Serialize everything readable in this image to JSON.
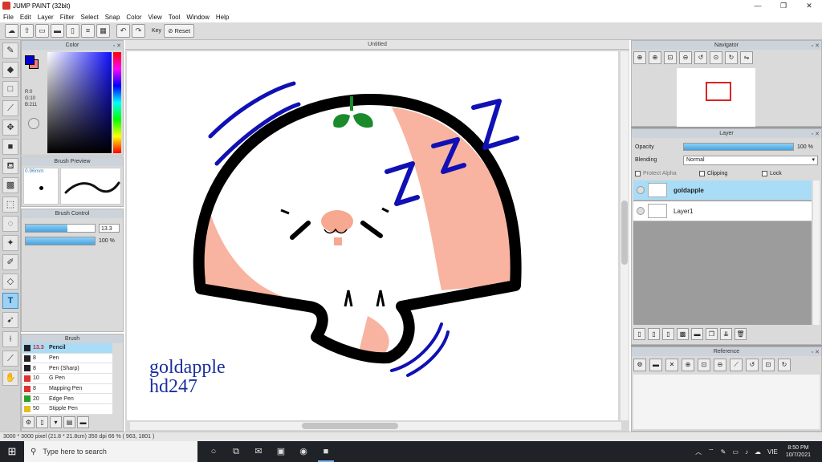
{
  "window": {
    "title": "JUMP PAINT (32bit)",
    "minimize": "—",
    "maximize": "❐",
    "close": "✕"
  },
  "menu": [
    "File",
    "Edit",
    "Layer",
    "Filter",
    "Select",
    "Snap",
    "Color",
    "View",
    "Tool",
    "Window",
    "Help"
  ],
  "toolbar": {
    "key_label": "Key",
    "reset_label": "Reset"
  },
  "color_panel": {
    "title": "Color",
    "r": "R:0",
    "g": "G:10",
    "b": "B:211",
    "fg_color": "#0000d3",
    "bg_color": "#f08080"
  },
  "brush_preview": {
    "title": "Brush Preview",
    "size": "0.96mm"
  },
  "brush_control": {
    "title": "Brush Control",
    "size_value": "13.3",
    "size_fraction": 0.6,
    "opacity_value": "100 %",
    "opacity_fraction": 1.0
  },
  "brush_list": {
    "title": "Brush",
    "items": [
      {
        "size": "13.3",
        "name": "Pencil",
        "color": "#222222",
        "selected": true
      },
      {
        "size": "8",
        "name": "Pen",
        "color": "#222222",
        "selected": false
      },
      {
        "size": "8",
        "name": "Pen (Sharp)",
        "color": "#222222",
        "selected": false
      },
      {
        "size": "10",
        "name": "G Pen",
        "color": "#e03030",
        "selected": false
      },
      {
        "size": "8",
        "name": "Mapping Pen",
        "color": "#e03030",
        "selected": false
      },
      {
        "size": "20",
        "name": "Edge Pen",
        "color": "#28a028",
        "selected": false
      },
      {
        "size": "50",
        "name": "Stipple Pen",
        "color": "#e0c020",
        "selected": false
      }
    ]
  },
  "canvas": {
    "tab_title": "Untitled",
    "signature_line1": "goldapple",
    "signature_line2": "hd247"
  },
  "navigator": {
    "title": "Navigator"
  },
  "layer_panel": {
    "title": "Layer",
    "opacity_label": "Opacity",
    "opacity_value": "100 %",
    "blending_label": "Blending",
    "blending_value": "Normal",
    "protect_alpha": "Protect Alpha",
    "clipping": "Clipping",
    "lock": "Lock",
    "layers": [
      {
        "name": "goldapple",
        "selected": true
      },
      {
        "name": "Layer1",
        "selected": false
      }
    ]
  },
  "reference": {
    "title": "Reference"
  },
  "status": {
    "text": "3000 * 3000 pixel   (21.8 * 21.8cm)   350 dpi   66 %   ( 963, 1801 )"
  },
  "taskbar": {
    "search_placeholder": "Type here to search",
    "time": "8:50 PM",
    "date": "10/7/2021",
    "lang": "VIE"
  },
  "icons": {
    "start": "windows-start-icon",
    "search": "search-icon",
    "tools": [
      "brush-icon",
      "eraser-icon",
      "rectangle-icon",
      "line-icon",
      "move-icon",
      "fill-shape-icon",
      "bucket-icon",
      "gradient-icon",
      "select-rect-icon",
      "lasso-icon",
      "magic-wand-icon",
      "select-pen-icon",
      "select-eraser-icon",
      "text-icon",
      "operation-icon",
      "eyedropper-icon",
      "eyedropper-2-icon",
      "hand-icon"
    ]
  }
}
